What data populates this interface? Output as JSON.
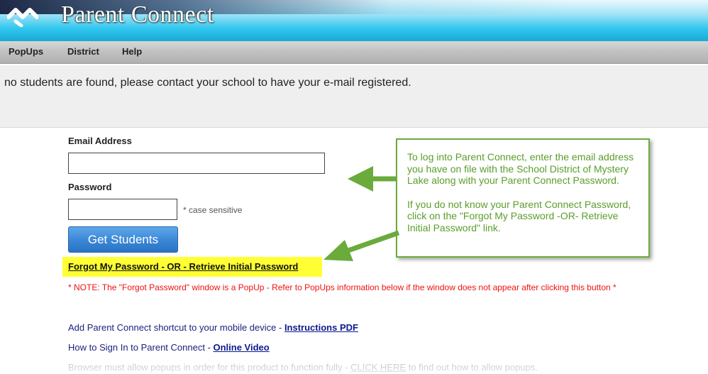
{
  "header": {
    "title": "Parent Connect",
    "logo_icon": "chevron-check-logo-icon"
  },
  "menu": {
    "items": [
      {
        "label": "PopUps"
      },
      {
        "label": "District"
      },
      {
        "label": "Help"
      }
    ]
  },
  "info": {
    "message": "no students are found, please contact your school to have your e-mail registered."
  },
  "form": {
    "email_label": "Email Address",
    "email_value": "",
    "password_label": "Password",
    "password_value": "",
    "password_hint": "* case sensitive",
    "submit_label": "Get Students",
    "forgot_link": "Forgot My Password - OR - Retrieve Initial Password",
    "note": "* NOTE: The \"Forgot Password\" window is a PopUp - Refer to PopUps information below if the window does not appear after clicking this button *"
  },
  "links": {
    "shortcut_text": "Add Parent Connect shortcut to your mobile device - ",
    "shortcut_link": "Instructions PDF",
    "signin_text": "How to Sign In to Parent Connect - ",
    "signin_link": "Online Video",
    "popups_text": "Browser must allow popups in order for this product to function fully - ",
    "popups_link": "CLICK HERE",
    "popups_suffix": " to find out how to allow popups."
  },
  "callout": {
    "paragraph1": "To log into Parent Connect, enter the email address you have on file with the School District of Mystery Lake along with your Parent Connect Password.",
    "paragraph2": "If you do not know your Parent Connect Password, click on the \"Forgot My Password -OR- Retrieve Initial Password\" link."
  },
  "colors": {
    "header_blue": "#2fc6ee",
    "button_blue": "#3a86d6",
    "highlight_yellow": "#ffff33",
    "note_red": "#ee1111",
    "callout_green": "#6aab3c",
    "link_navy": "#0b1a8c"
  }
}
